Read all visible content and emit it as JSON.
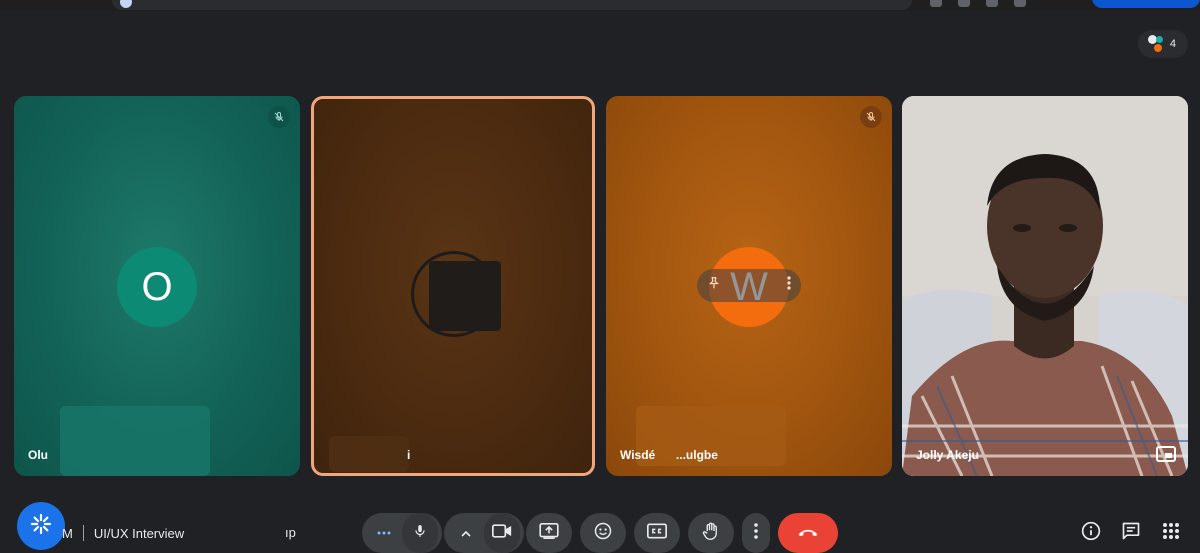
{
  "browser": {
    "url_text": ""
  },
  "participants_count": "4",
  "tiles": [
    {
      "name": "Olu",
      "avatar_letter": "O",
      "muted": true
    },
    {
      "name": "i"
    },
    {
      "name": "Wisdé— ...ulgbe",
      "name_left": "Wisdé",
      "name_right": "...ulgbe",
      "avatar_letter": "W",
      "muted": true
    },
    {
      "name": "Jolly Akeju"
    }
  ],
  "meeting": {
    "prefix": "M",
    "title": "UI/UX Interview",
    "code_tail": "ıp"
  },
  "colors": {
    "accent": "#1a73e8",
    "hangup": "#ea4335",
    "tile1": "#136358",
    "tile2": "#4a2a10",
    "tile3": "#a1560f",
    "highlight_border": "#f0a77d"
  },
  "icons": [
    "mic-off-icon",
    "mic-icon",
    "video-icon",
    "present-icon",
    "emoji-icon",
    "captions-icon",
    "hand-icon",
    "more-vert-icon",
    "call-end-icon",
    "info-icon",
    "chat-icon",
    "apps-icon",
    "pin-icon",
    "pip-icon",
    "assistant-icon"
  ]
}
